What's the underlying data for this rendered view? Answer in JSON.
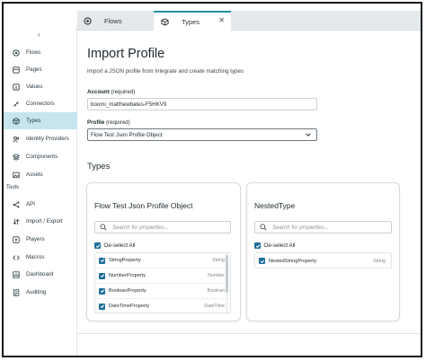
{
  "tabs": [
    {
      "label": "Flows",
      "icon": "flow-icon"
    },
    {
      "label": "Types",
      "icon": "types-icon",
      "active": true,
      "close": "✕"
    }
  ],
  "sidebar": {
    "collapse": "‹",
    "items": [
      {
        "label": "Flows",
        "icon": "flow-icon"
      },
      {
        "label": "Pages",
        "icon": "page-icon"
      },
      {
        "label": "Values",
        "icon": "values-icon"
      },
      {
        "label": "Connectors",
        "icon": "connector-icon"
      },
      {
        "label": "Types",
        "icon": "types-icon",
        "active": true
      },
      {
        "label": "Identity Providers",
        "icon": "identity-icon"
      },
      {
        "label": "Components",
        "icon": "component-icon"
      },
      {
        "label": "Assets",
        "icon": "assets-icon"
      }
    ],
    "tools_label": "Tools",
    "tools": [
      {
        "label": "API",
        "icon": "api-icon"
      },
      {
        "label": "Import / Export",
        "icon": "import-export-icon"
      },
      {
        "label": "Players",
        "icon": "player-icon"
      },
      {
        "label": "Macros",
        "icon": "code-icon"
      },
      {
        "label": "Dashboard",
        "icon": "dashboard-icon"
      },
      {
        "label": "Auditing",
        "icon": "auditing-icon"
      }
    ]
  },
  "main": {
    "title": "Import Profile",
    "subtitle": "Import a JSON profile from Integrate and create matching types",
    "account": {
      "label": "Account",
      "required": " (required)",
      "value": "boomi_matthewbates-F5HKV9"
    },
    "profile": {
      "label": "Profile",
      "required": " (required)",
      "value": "Flow Test Json Profile Object"
    },
    "types_heading": "Types",
    "cards": [
      {
        "title": "Flow Test Json Profile Object",
        "search_placeholder": "Search for properties...",
        "deselect": "De-select All",
        "rows": [
          {
            "name": "StringProperty",
            "type": "String"
          },
          {
            "name": "NumberProperty",
            "type": "Number"
          },
          {
            "name": "BooleanProperty",
            "type": "Boolean"
          },
          {
            "name": "DateTimeProperty",
            "type": "DateTime"
          }
        ]
      },
      {
        "title": "NestedType",
        "search_placeholder": "Search for properties...",
        "deselect": "De-select All",
        "rows": [
          {
            "name": "NestedStringProperty",
            "type": "String"
          }
        ]
      }
    ]
  },
  "colors": {
    "accent": "#1f8ea4",
    "active_nav": "#c7e5ee",
    "checkbox": "#1f6f98"
  }
}
